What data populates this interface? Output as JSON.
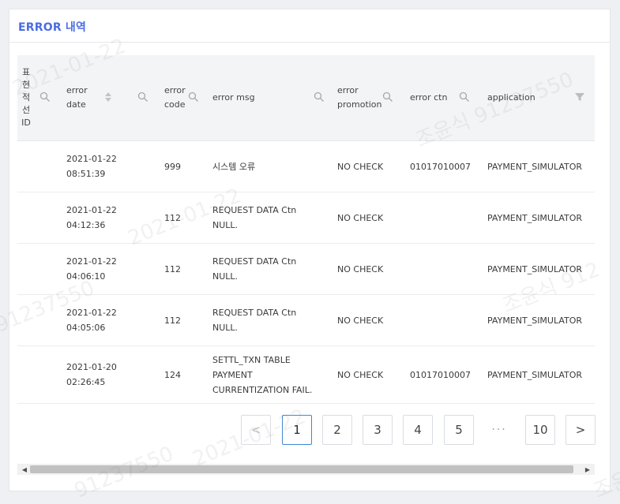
{
  "panel": {
    "title": "ERROR 내역"
  },
  "table": {
    "columns": [
      {
        "id": "id",
        "label": "표\n현\n적\n선\nID",
        "search": true
      },
      {
        "id": "error_date",
        "label": "error\ndate",
        "search": true,
        "sort": true
      },
      {
        "id": "error_code",
        "label": "error\ncode",
        "search": true
      },
      {
        "id": "error_msg",
        "label": "error msg",
        "search": true
      },
      {
        "id": "error_promotion",
        "label": "error\npromotion",
        "search": true
      },
      {
        "id": "error_ctn",
        "label": "error ctn",
        "search": true
      },
      {
        "id": "application",
        "label": "application",
        "filter": true
      }
    ],
    "rows": [
      {
        "id": "",
        "error_date": "2021-01-22\n08:51:39",
        "error_code": "999",
        "error_msg": "시스템 오류",
        "error_promotion": "NO CHECK",
        "error_ctn": "01017010007",
        "application": "PAYMENT_SIMULATOR"
      },
      {
        "id": "",
        "error_date": "2021-01-22\n04:12:36",
        "error_code": "112",
        "error_msg": "REQUEST DATA Ctn\nNULL.",
        "error_promotion": "NO CHECK",
        "error_ctn": "",
        "application": "PAYMENT_SIMULATOR"
      },
      {
        "id": "",
        "error_date": "2021-01-22\n04:06:10",
        "error_code": "112",
        "error_msg": "REQUEST DATA Ctn\nNULL.",
        "error_promotion": "NO CHECK",
        "error_ctn": "",
        "application": "PAYMENT_SIMULATOR"
      },
      {
        "id": "",
        "error_date": "2021-01-22\n04:05:06",
        "error_code": "112",
        "error_msg": "REQUEST DATA Ctn\nNULL.",
        "error_promotion": "NO CHECK",
        "error_ctn": "",
        "application": "PAYMENT_SIMULATOR"
      },
      {
        "id": "",
        "error_date": "2021-01-20\n02:26:45",
        "error_code": "124",
        "error_msg": "SETTL_TXN TABLE\nPAYMENT\nCURRENTIZATION FAIL.",
        "error_promotion": "NO CHECK",
        "error_ctn": "01017010007",
        "application": "PAYMENT_SIMULATOR"
      }
    ]
  },
  "pagination": {
    "prev": "<",
    "pages": [
      "1",
      "2",
      "3",
      "4",
      "5"
    ],
    "ellipsis": "···",
    "last": "10",
    "next": ">",
    "current": "1"
  },
  "watermarks": [
    "2021-01-22",
    "조윤식 91237550",
    "2021-01-22",
    "91237550",
    "조윤식 912",
    "2021-01-22",
    "91237550",
    "조윤"
  ],
  "colors": {
    "accent": "#4a6ee0",
    "active_page_border": "#3f88d4"
  }
}
